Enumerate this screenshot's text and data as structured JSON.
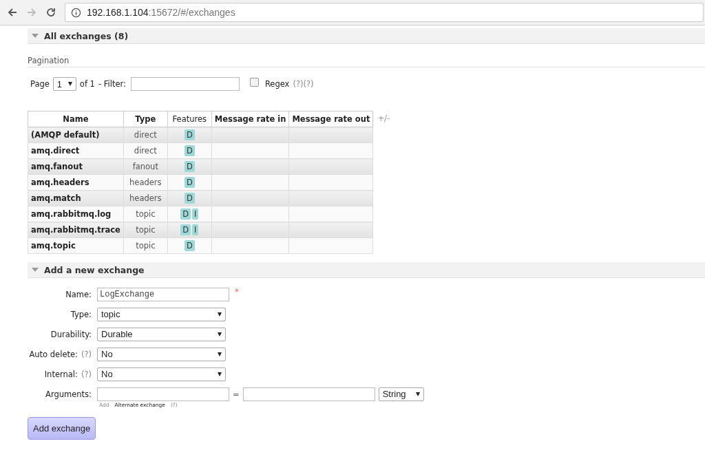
{
  "browser": {
    "url_host": "192.168.1.104",
    "url_rest": ":15672/#/exchanges"
  },
  "exchanges_section": {
    "title": "All exchanges (8)",
    "expanded": true
  },
  "pagination": {
    "heading": "Pagination",
    "page_label": "Page",
    "page_value": "1",
    "of_label": "of 1",
    "filter_label": "- Filter:",
    "regex_checked": false,
    "regex_label": "Regex",
    "regex_help": "(?)(?)"
  },
  "table": {
    "columns": [
      "Name",
      "Type",
      "Features",
      "Message rate in",
      "Message rate out"
    ],
    "toggle": "+/-",
    "rows": [
      {
        "name": "(AMQP default)",
        "type": "direct",
        "features": [
          "D"
        ]
      },
      {
        "name": "amq.direct",
        "type": "direct",
        "features": [
          "D"
        ]
      },
      {
        "name": "amq.fanout",
        "type": "fanout",
        "features": [
          "D"
        ]
      },
      {
        "name": "amq.headers",
        "type": "headers",
        "features": [
          "D"
        ]
      },
      {
        "name": "amq.match",
        "type": "headers",
        "features": [
          "D"
        ]
      },
      {
        "name": "amq.rabbitmq.log",
        "type": "topic",
        "features": [
          "D",
          "I"
        ]
      },
      {
        "name": "amq.rabbitmq.trace",
        "type": "topic",
        "features": [
          "D",
          "I"
        ]
      },
      {
        "name": "amq.topic",
        "type": "topic",
        "features": [
          "D"
        ]
      }
    ]
  },
  "add_section": {
    "title": "Add a new exchange",
    "expanded": true
  },
  "form": {
    "fields": [
      {
        "kind": "text",
        "label": "Name:",
        "value": "LogExchange",
        "required_mark": "*"
      },
      {
        "kind": "select",
        "label": "Type:",
        "value": "topic"
      },
      {
        "kind": "select",
        "label": "Durability:",
        "value": "Durable"
      },
      {
        "kind": "select",
        "label": "Auto delete:",
        "help": "(?)",
        "value": "No"
      },
      {
        "kind": "select",
        "label": "Internal:",
        "help": "(?)",
        "value": "No"
      }
    ],
    "arguments": {
      "label": "Arguments:",
      "equals": "=",
      "type_value": "String",
      "add_link": "Add",
      "alt_link": "Alternate exchange",
      "alt_help": "(?)"
    },
    "submit": "Add exchange"
  }
}
